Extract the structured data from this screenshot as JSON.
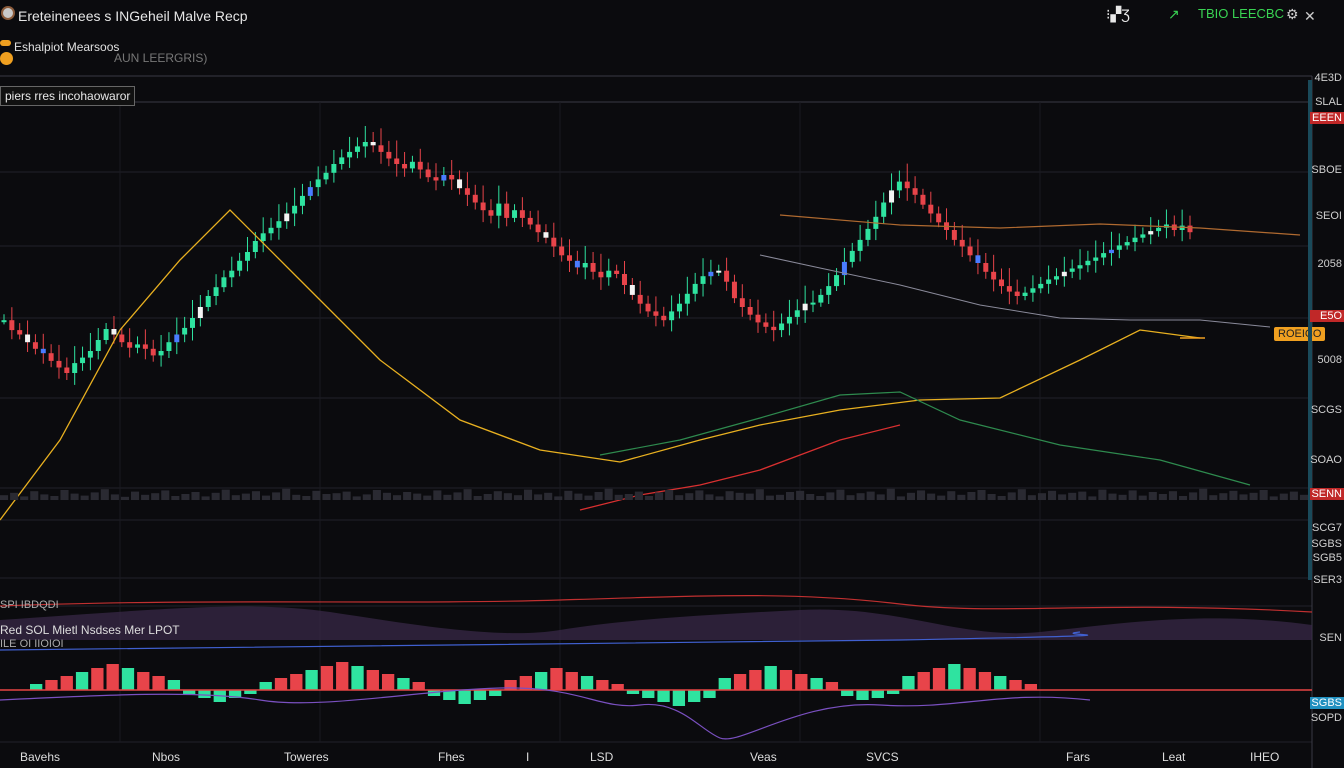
{
  "app": {
    "title": "Ereteinenees s INGeheil Malve Recp",
    "status_text": "TBIO LEECBC",
    "colors": {
      "background": "#0b0b0e",
      "up": "#2fe3a0",
      "down": "#e8444a",
      "accent": "#f0a020",
      "status": "#39d353"
    }
  },
  "toolbar": {
    "icons": [
      "grid-icon",
      "settings-icon",
      "help-icon",
      "fullscreen-icon"
    ],
    "icon_glyphs": [
      "⁝▞Ʒ",
      "↗",
      "⚙",
      "✕"
    ]
  },
  "header": {
    "symbol_label": "Eshalpiot Mearsoos",
    "pair_label": "AUN LEERGRIS)"
  },
  "indicators": {
    "main_label": "piers rres incohaowaror",
    "lower_label": "Red SOL Mietl Nsdses Mer LPOT",
    "lower_sub": "ILE OI IIOIOI",
    "osc_label": "SPI IBDQDI"
  },
  "price_tag": "ROEICO",
  "y_ticks": [
    {
      "label": "4E3D",
      "kind": "plain"
    },
    {
      "label": "SLAL",
      "kind": "plain"
    },
    {
      "label": "EEEN",
      "kind": "red"
    },
    {
      "label": "SBOE",
      "kind": "plain"
    },
    {
      "label": "SEOI",
      "kind": "plain"
    },
    {
      "label": "2058",
      "kind": "plain"
    },
    {
      "label": "E5O",
      "kind": "red"
    },
    {
      "label": "5008",
      "kind": "plain"
    },
    {
      "label": "SCGS",
      "kind": "plain"
    },
    {
      "label": "SOAO",
      "kind": "plain"
    },
    {
      "label": "SENN",
      "kind": "red"
    },
    {
      "label": "SCG7",
      "kind": "plain"
    },
    {
      "label": "SGBS",
      "kind": "plain"
    },
    {
      "label": "SGB5",
      "kind": "plain"
    },
    {
      "label": "SER3",
      "kind": "plain"
    },
    {
      "label": "SEN",
      "kind": "plain"
    },
    {
      "label": "SGBS",
      "kind": "blue"
    },
    {
      "label": "SOPD",
      "kind": "plain"
    }
  ],
  "x_ticks": [
    "Bavehs",
    "Nbos",
    "Toweres",
    "Fhes",
    "I",
    "LSD",
    "Veas",
    "SVCS",
    "Fars",
    "Leat",
    "IHEO"
  ],
  "chart_data": {
    "type": "candlestick",
    "title": "",
    "candles_close": [
      218,
      209,
      205,
      198,
      192,
      188,
      181,
      175,
      170,
      179,
      184,
      190,
      200,
      210,
      205,
      198,
      193,
      196,
      192,
      186,
      190,
      198,
      205,
      211,
      220,
      230,
      240,
      248,
      257,
      263,
      272,
      280,
      290,
      297,
      302,
      308,
      315,
      322,
      331,
      339,
      346,
      352,
      360,
      366,
      371,
      376,
      380,
      377,
      371,
      365,
      360,
      356,
      362,
      355,
      348,
      345,
      350,
      346,
      338,
      332,
      325,
      318,
      313,
      324,
      311,
      318,
      311,
      305,
      298,
      293,
      285,
      277,
      272,
      266,
      270,
      262,
      257,
      263,
      260,
      250,
      241,
      233,
      226,
      222,
      218,
      226,
      233,
      242,
      251,
      258,
      262,
      263,
      253,
      238,
      230,
      223,
      216,
      212,
      209,
      215,
      221,
      227,
      233,
      234,
      241,
      249,
      259,
      271,
      281,
      291,
      301,
      312,
      325,
      336,
      344,
      338,
      332,
      323,
      315,
      307,
      300,
      291,
      285,
      277,
      270,
      262,
      255,
      249,
      244,
      240,
      243,
      247,
      251,
      255,
      258,
      262,
      265,
      268,
      272,
      275,
      279,
      282,
      286,
      289,
      293,
      296,
      299,
      302,
      305,
      300,
      304,
      298
    ],
    "ma_line_yellow": [
      [
        0,
        520
      ],
      [
        60,
        440
      ],
      [
        120,
        330
      ],
      [
        180,
        260
      ],
      [
        230,
        210
      ],
      [
        300,
        280
      ],
      [
        380,
        360
      ],
      [
        460,
        420
      ],
      [
        540,
        450
      ],
      [
        620,
        462
      ],
      [
        700,
        440
      ],
      [
        760,
        425
      ],
      [
        840,
        410
      ],
      [
        920,
        400
      ],
      [
        1000,
        398
      ],
      [
        1080,
        360
      ],
      [
        1140,
        330
      ],
      [
        1200,
        338
      ]
    ],
    "ma_line_orange": [
      [
        780,
        215
      ],
      [
        900,
        225
      ],
      [
        1000,
        228
      ],
      [
        1100,
        224
      ],
      [
        1200,
        228
      ],
      [
        1300,
        235
      ]
    ],
    "ma_line_gray": [
      [
        760,
        255
      ],
      [
        820,
        268
      ],
      [
        900,
        285
      ],
      [
        980,
        305
      ],
      [
        1060,
        318
      ],
      [
        1130,
        320
      ],
      [
        1200,
        320
      ],
      [
        1270,
        327
      ]
    ],
    "ma_line_green": [
      [
        600,
        455
      ],
      [
        680,
        440
      ],
      [
        760,
        418
      ],
      [
        840,
        395
      ],
      [
        900,
        392
      ],
      [
        960,
        420
      ],
      [
        1060,
        445
      ],
      [
        1160,
        460
      ],
      [
        1250,
        485
      ]
    ],
    "ma_line_red": [
      [
        580,
        510
      ],
      [
        640,
        495
      ],
      [
        700,
        485
      ],
      [
        760,
        470
      ],
      [
        800,
        455
      ],
      [
        840,
        440
      ],
      [
        900,
        425
      ]
    ],
    "volume": [
      12,
      18,
      9,
      22,
      14,
      10,
      25,
      16,
      11,
      19,
      27,
      14,
      8,
      21,
      13,
      17,
      24,
      10,
      15,
      20,
      9,
      18,
      26,
      12,
      16,
      22,
      11,
      19,
      28,
      13,
      10,
      23,
      15,
      17,
      21,
      9,
      14,
      25,
      18,
      12,
      20,
      16,
      11,
      24,
      13,
      19,
      27,
      10,
      15,
      22,
      17,
      12,
      26,
      14,
      18,
      9,
      23,
      16,
      11,
      20,
      28,
      13,
      15,
      21,
      10,
      19,
      25,
      12,
      17,
      24,
      14,
      9,
      22,
      18,
      16,
      27,
      11,
      13,
      20,
      23,
      15,
      10,
      19,
      26,
      12,
      17,
      21,
      14,
      28,
      9,
      18,
      24,
      16,
      11,
      22,
      13,
      20,
      25,
      15,
      10,
      19,
      27,
      12,
      17,
      23,
      14,
      18,
      21,
      9,
      26,
      16,
      13,
      24,
      11,
      20,
      15,
      22,
      10,
      19,
      28,
      12,
      17,
      23,
      14,
      18,
      25,
      9,
      16,
      21,
      13
    ],
    "histogram_bars": [
      6,
      10,
      14,
      18,
      22,
      26,
      22,
      18,
      14,
      10,
      -4,
      -8,
      -12,
      -8,
      -4,
      8,
      12,
      16,
      20,
      24,
      28,
      24,
      20,
      16,
      12,
      8,
      -6,
      -10,
      -14,
      -10,
      -6,
      10,
      14,
      18,
      22,
      18,
      14,
      10,
      6,
      -4,
      -8,
      -12,
      -16,
      -12,
      -8,
      12,
      16,
      20,
      24,
      20,
      16,
      12,
      8,
      -6,
      -10,
      -8,
      -4,
      14,
      18,
      22,
      26,
      22,
      18,
      14,
      10,
      6
    ],
    "ylim": [
      0,
      400
    ],
    "grid": true
  }
}
